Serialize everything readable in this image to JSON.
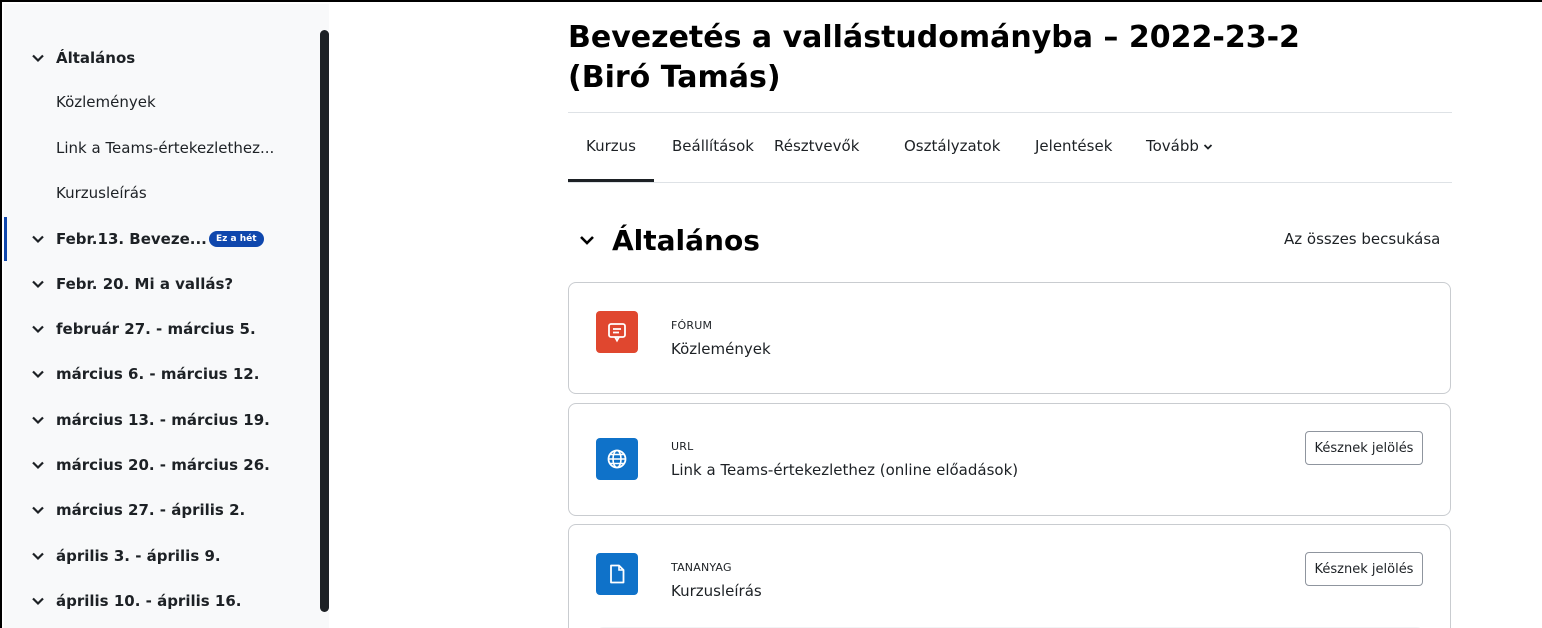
{
  "course": {
    "title": "Bevezetés a vallástudományba – 2022-23-2 (Biró Tamás)"
  },
  "sidebar": {
    "items": [
      {
        "kind": "section",
        "label": "Általános"
      },
      {
        "kind": "link",
        "label": "Közlemények"
      },
      {
        "kind": "link",
        "label": "Link a Teams-értekezlethez..."
      },
      {
        "kind": "link",
        "label": "Kurzusleírás"
      },
      {
        "kind": "section",
        "label": "Febr.13. Beveze...",
        "badge": "Ez a hét",
        "active": true
      },
      {
        "kind": "section",
        "label": "Febr. 20. Mi a vallás?"
      },
      {
        "kind": "section",
        "label": "február 27. - március 5."
      },
      {
        "kind": "section",
        "label": "március 6. - március 12."
      },
      {
        "kind": "section",
        "label": "március 13. - március 19."
      },
      {
        "kind": "section",
        "label": "március 20. - március 26."
      },
      {
        "kind": "section",
        "label": "március 27. - április 2."
      },
      {
        "kind": "section",
        "label": "április 3. - április 9."
      },
      {
        "kind": "section",
        "label": "április 10. - április 16."
      }
    ]
  },
  "tabs": [
    {
      "label": "Kurzus",
      "active": true
    },
    {
      "label": "Beállítások"
    },
    {
      "label": "Résztvevők"
    },
    {
      "label": "Osztályzatok"
    },
    {
      "label": "Jelentések"
    },
    {
      "label": "Tovább"
    }
  ],
  "section": {
    "title": "Általános",
    "collapse_all": "Az összes becsukása"
  },
  "activities": [
    {
      "type": "FÓRUM",
      "name": "Közlemények",
      "icon": "forum-icon",
      "color": "#e0472f"
    },
    {
      "type": "URL",
      "name": "Link a Teams-értekezlethez (online előadások)",
      "icon": "globe-icon",
      "color": "#0f72c9",
      "button": "Késznek jelölés"
    },
    {
      "type": "TANANYAG",
      "name": "Kurzusleírás",
      "icon": "file-icon",
      "color": "#0f72c9",
      "button": "Késznek jelölés"
    }
  ],
  "colors": {
    "accent": "#0f47ad",
    "forum": "#e0472f",
    "resource": "#0f72c9"
  }
}
